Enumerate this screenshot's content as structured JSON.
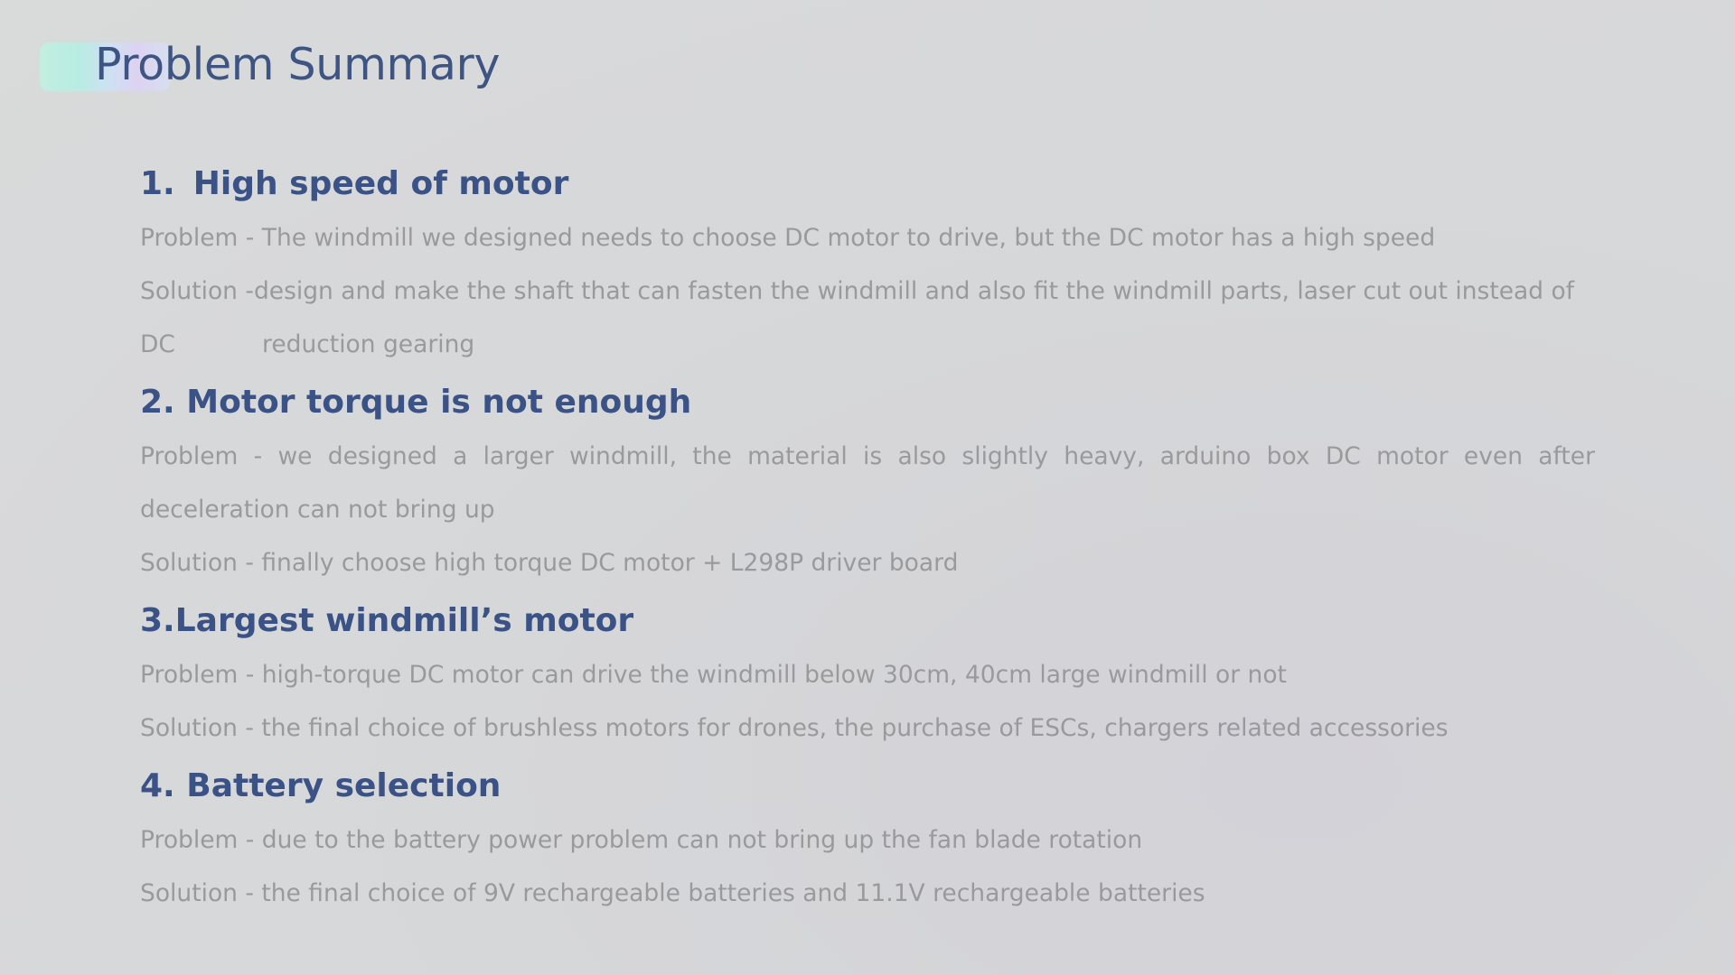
{
  "slide": {
    "title": "Problem Summary",
    "sections": [
      {
        "heading_number": "1.",
        "heading_text": "High speed of motor",
        "problem": "Problem - The windmill we designed needs to choose DC motor to drive, but the DC motor has a high speed",
        "solution_line1": "Solution -design and make the shaft that can fasten the windmill and also fit the windmill parts, laser cut out instead of",
        "solution_line2_a": "DC",
        "solution_line2_b": "reduction gearing"
      },
      {
        "heading": "2. Motor torque is not enough",
        "problem": "Problem - we designed a larger windmill, the material is also slightly heavy, arduino box DC motor even after deceleration can not bring up",
        "solution": "Solution - finally choose high torque DC motor + L298P driver board"
      },
      {
        "heading": "3.Largest windmill’s motor",
        "problem": "Problem - high-torque DC motor can drive the windmill below 30cm, 40cm large windmill or not",
        "solution": "Solution - the final choice of brushless motors for drones, the purchase of ESCs, chargers related accessories"
      },
      {
        "heading": "4. Battery selection",
        "problem": "Problem - due to the battery power problem can not bring up the fan blade rotation",
        "solution": "Solution - the final choice of 9V rechargeable batteries and 11.1V rechargeable batteries"
      }
    ]
  },
  "colors": {
    "title": "#3e5482",
    "heading": "#3a5286",
    "body_text": "#9a9a9d",
    "background": "#d7d8d9",
    "accent_gradient": [
      "#c2efe0",
      "#ddd2f2"
    ]
  }
}
